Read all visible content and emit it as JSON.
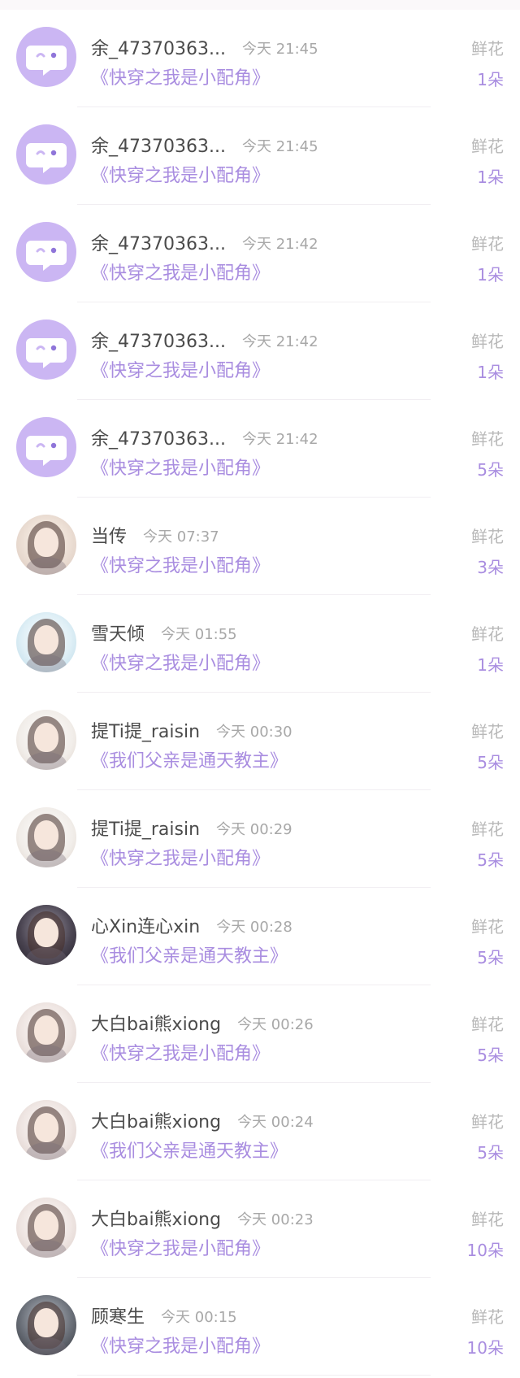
{
  "rows": [
    {
      "name": "余_47370363...",
      "time": "今天 21:45",
      "book": "《快穿之我是小配角》",
      "type": "鲜花",
      "count": "1朵",
      "avatar": "default"
    },
    {
      "name": "余_47370363...",
      "time": "今天 21:45",
      "book": "《快穿之我是小配角》",
      "type": "鲜花",
      "count": "1朵",
      "avatar": "default"
    },
    {
      "name": "余_47370363...",
      "time": "今天 21:42",
      "book": "《快穿之我是小配角》",
      "type": "鲜花",
      "count": "1朵",
      "avatar": "default"
    },
    {
      "name": "余_47370363...",
      "time": "今天 21:42",
      "book": "《快穿之我是小配角》",
      "type": "鲜花",
      "count": "1朵",
      "avatar": "default"
    },
    {
      "name": "余_47370363...",
      "time": "今天 21:42",
      "book": "《快穿之我是小配角》",
      "type": "鲜花",
      "count": "5朵",
      "avatar": "default"
    },
    {
      "name": "当传",
      "time": "今天 07:37",
      "book": "《快穿之我是小配角》",
      "type": "鲜花",
      "count": "3朵",
      "avatar": "photo"
    },
    {
      "name": "雪天倾",
      "time": "今天 01:55",
      "book": "《快穿之我是小配角》",
      "type": "鲜花",
      "count": "1朵",
      "avatar": "photo"
    },
    {
      "name": "提Ti提_raisin",
      "time": "今天 00:30",
      "book": "《我们父亲是通天教主》",
      "type": "鲜花",
      "count": "5朵",
      "avatar": "photo"
    },
    {
      "name": "提Ti提_raisin",
      "time": "今天 00:29",
      "book": "《快穿之我是小配角》",
      "type": "鲜花",
      "count": "5朵",
      "avatar": "photo"
    },
    {
      "name": "心Xin连心xin",
      "time": "今天 00:28",
      "book": "《我们父亲是通天教主》",
      "type": "鲜花",
      "count": "5朵",
      "avatar": "photo"
    },
    {
      "name": "大白bai熊xiong",
      "time": "今天 00:26",
      "book": "《快穿之我是小配角》",
      "type": "鲜花",
      "count": "5朵",
      "avatar": "photo"
    },
    {
      "name": "大白bai熊xiong",
      "time": "今天 00:24",
      "book": "《我们父亲是通天教主》",
      "type": "鲜花",
      "count": "5朵",
      "avatar": "photo"
    },
    {
      "name": "大白bai熊xiong",
      "time": "今天 00:23",
      "book": "《快穿之我是小配角》",
      "type": "鲜花",
      "count": "10朵",
      "avatar": "photo"
    },
    {
      "name": "顾寒生",
      "time": "今天 00:15",
      "book": "《快穿之我是小配角》",
      "type": "鲜花",
      "count": "10朵",
      "avatar": "photo"
    }
  ],
  "colors": {
    "accent": "#a98de0",
    "avatar_default": "#cbb6f3",
    "text": "#4b4b4b",
    "muted": "#a8a8a8"
  },
  "icons": {
    "default_avatar": "chat-bubble-face-icon"
  }
}
